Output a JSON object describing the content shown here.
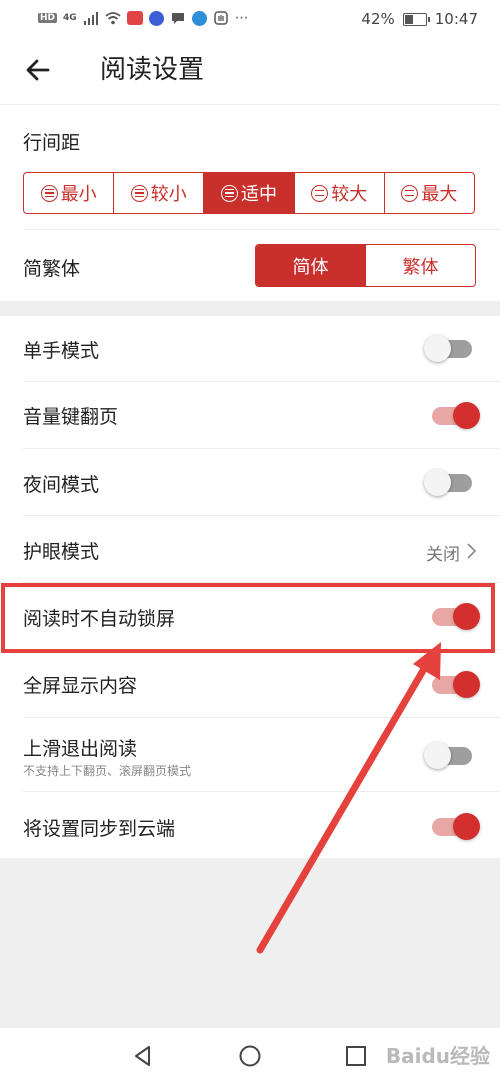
{
  "status_bar": {
    "network_badge": "HD",
    "network_type": "4G",
    "icons": [
      "signal-icon",
      "wifi-icon",
      "app-icon",
      "music-icon",
      "chat-icon",
      "shield-icon",
      "hand-icon",
      "more-icon"
    ],
    "battery_percent": "42%",
    "battery_level": 0.42,
    "time": "10:47"
  },
  "header": {
    "title": "阅读设置"
  },
  "line_spacing": {
    "label": "行间距",
    "options": [
      "最小",
      "较小",
      "适中",
      "较大",
      "最大"
    ],
    "selected_index": 2
  },
  "script_type": {
    "label": "简繁体",
    "options": [
      "简体",
      "繁体"
    ],
    "selected_index": 0
  },
  "settings": [
    {
      "label": "单手模式",
      "state": "off"
    },
    {
      "label": "音量键翻页",
      "state": "on"
    },
    {
      "label": "夜间模式",
      "state": "off"
    },
    {
      "label": "护眼模式",
      "value": "关闭"
    },
    {
      "label": "阅读时不自动锁屏",
      "state": "on"
    },
    {
      "label": "全屏显示内容",
      "state": "on"
    },
    {
      "label": "上滑退出阅读",
      "sublabel": "不支持上下翻页、滚屏翻页模式",
      "state": "off"
    },
    {
      "label": "将设置同步到云端",
      "state": "on"
    }
  ],
  "colors": {
    "accent": "#c9302c",
    "toggle_on": "#d32f2f",
    "annotation": "#e5423d"
  },
  "watermark": "Baidu经验"
}
